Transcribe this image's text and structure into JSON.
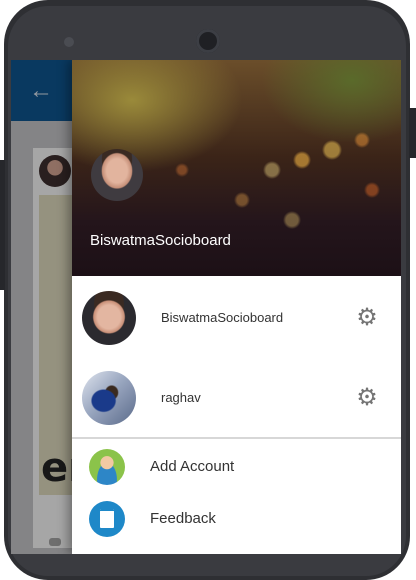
{
  "drawer": {
    "header_name": "BiswatmaSocioboard",
    "accounts": [
      {
        "name": "BiswatmaSocioboard"
      },
      {
        "name": "raghav"
      }
    ],
    "menu": [
      {
        "label": "Add Account",
        "icon": "add-account-icon"
      },
      {
        "label": "Feedback",
        "icon": "feedback-icon"
      }
    ]
  },
  "app": {
    "appbar_color": "#0d4f86",
    "back_icon": "arrow-back-icon",
    "card_text": "er"
  }
}
